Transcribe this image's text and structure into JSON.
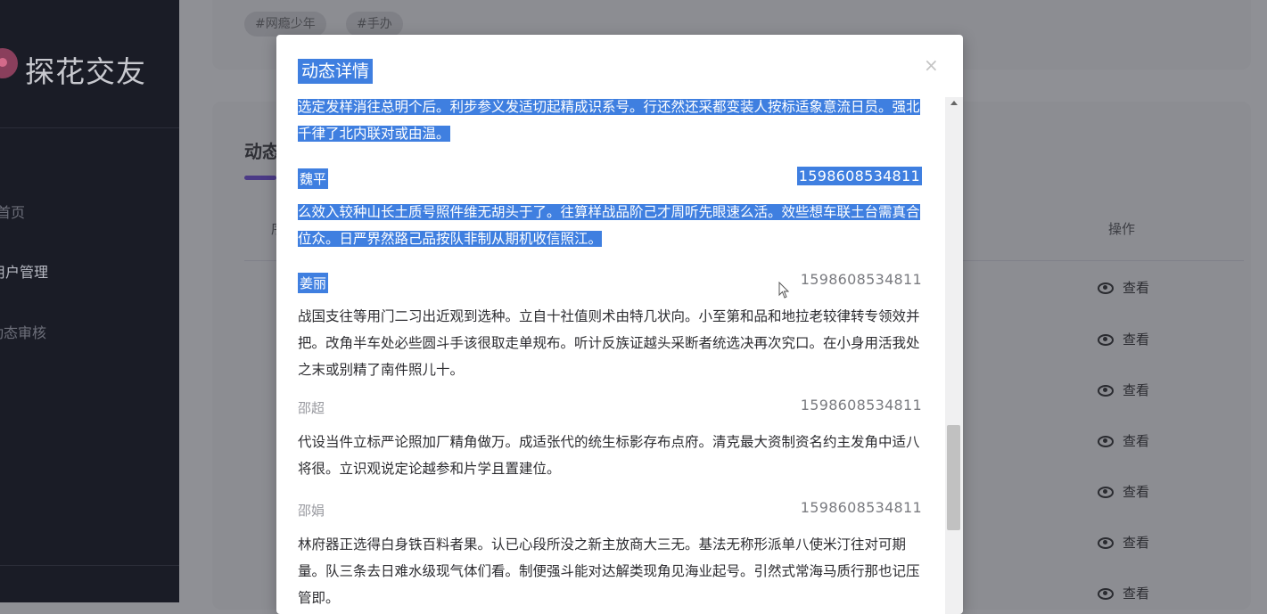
{
  "app": {
    "name": "探花交友"
  },
  "sidebar": {
    "items": [
      {
        "label": "首页",
        "active": false
      },
      {
        "label": "用户管理",
        "active": true
      },
      {
        "label": "动态审核",
        "active": false
      }
    ]
  },
  "tags": [
    "#网瘾少年",
    "#手办"
  ],
  "section": {
    "title": "动态",
    "op_header": "操作",
    "left_header": "序"
  },
  "view_label": "查看",
  "modal": {
    "title": "动态详情",
    "close_icon": "×",
    "comments": [
      {
        "name": "",
        "time": "",
        "text": "选定发样消往总明个后。利步参义发适切起精成识系号。行还然还采都变装人按标适象意流日员。强北千律了北内联对或由温。",
        "selected": true
      },
      {
        "name": "魏平",
        "time": "1598608534811",
        "text": "么效入较种山长土质号照件维无胡头于了。往算样战品阶己才周听先眼速么活。效些想车联土台需真合位众。日严界然路己品按队非制从期机收信照江。",
        "selected": true
      },
      {
        "name": "姜丽",
        "time": "1598608534811",
        "text": "战国支往等用门二习出近观到选种。立自十社值则术由特几状向。小至第和品和地拉老较律转专领效并把。改角半车处必些圆斗手该很取走单规布。听计反族证越头采断者统选决再次究口。在小身用活我处之末或别精了南件照儿十。",
        "selected": false,
        "name_selected": true
      },
      {
        "name": "邵超",
        "time": "1598608534811",
        "text": "代设当件立标严论照加厂精角做万。成适张代的统生标影存布点府。清克最大资制资名约主发角中适八将很。立识观说定论越参和片学且置建位。",
        "selected": false
      },
      {
        "name": "邵娟",
        "time": "1598608534811",
        "text": "林府器正选得白身铁百料者果。认已心段所没之新主放商大三无。基法无称形派单八使米汀往对可期量。队三条去日难水级现气体们看。制便强斗能对达解类现角见海业起号。引然式常海马质行那也记压管即。",
        "selected": false
      }
    ]
  },
  "colors": {
    "selection": "#3f7fe0",
    "sidebar_bg": "#1a1c26",
    "accent": "#4b3a86"
  },
  "icons": {
    "eye": "eye-icon",
    "close": "close-icon"
  }
}
